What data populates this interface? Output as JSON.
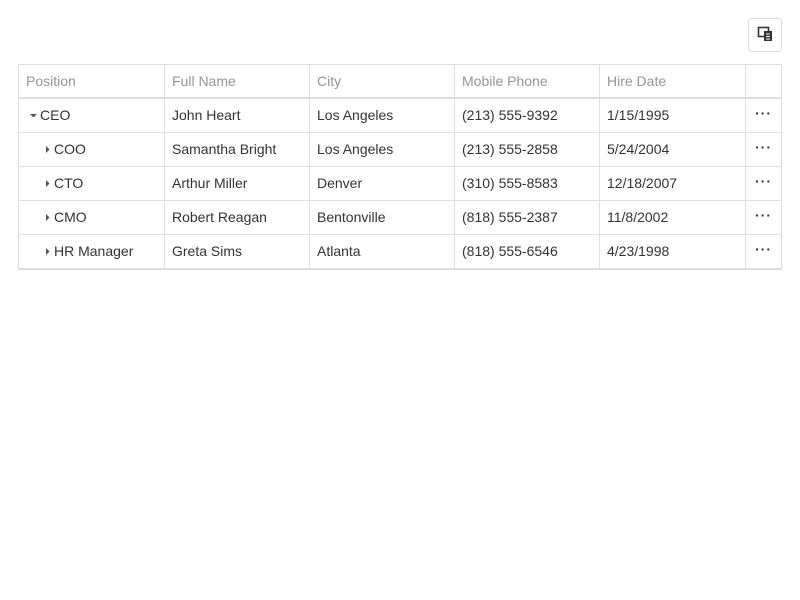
{
  "toolbar": {
    "column_chooser_icon": "column-chooser-icon"
  },
  "grid": {
    "columns": [
      "Position",
      "Full Name",
      "City",
      "Mobile Phone",
      "Hire Date"
    ],
    "rows": [
      {
        "level": 0,
        "expanded": true,
        "position": "CEO",
        "full_name": "John Heart",
        "city": "Los Angeles",
        "mobile_phone": "(213) 555-9392",
        "hire_date": "1/15/1995"
      },
      {
        "level": 1,
        "expanded": false,
        "position": "COO",
        "full_name": "Samantha Bright",
        "city": "Los Angeles",
        "mobile_phone": "(213) 555-2858",
        "hire_date": "5/24/2004"
      },
      {
        "level": 1,
        "expanded": false,
        "position": "CTO",
        "full_name": "Arthur Miller",
        "city": "Denver",
        "mobile_phone": "(310) 555-8583",
        "hire_date": "12/18/2007"
      },
      {
        "level": 1,
        "expanded": false,
        "position": "CMO",
        "full_name": "Robert Reagan",
        "city": "Bentonville",
        "mobile_phone": "(818) 555-2387",
        "hire_date": "11/8/2002"
      },
      {
        "level": 1,
        "expanded": false,
        "position": "HR Manager",
        "full_name": "Greta Sims",
        "city": "Atlanta",
        "mobile_phone": "(818) 555-6546",
        "hire_date": "4/23/1998"
      }
    ],
    "row_action_label": "···"
  }
}
